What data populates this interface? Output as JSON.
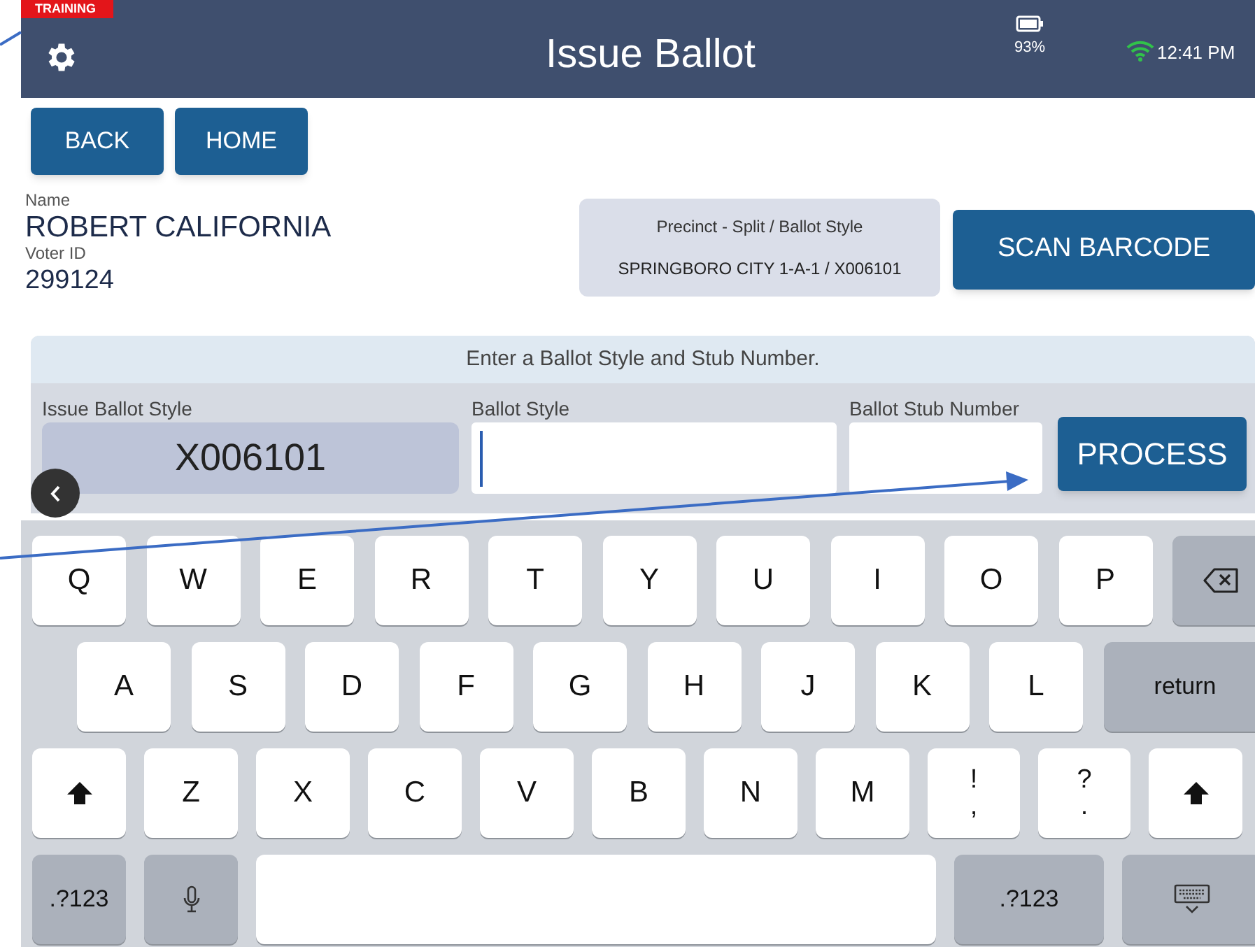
{
  "header": {
    "badge": "TRAINING",
    "title": "Issue Ballot",
    "battery": "93%",
    "time": "12:41 PM"
  },
  "nav_buttons": [
    "BACK",
    "HOME"
  ],
  "voter": {
    "name_label": "Name",
    "name": "ROBERT CALIFORNIA",
    "id_label": "Voter ID",
    "id": "299124"
  },
  "precinct": {
    "label": "Precinct - Split / Ballot Style",
    "value": "SPRINGBORO CITY 1-A-1 / X006101"
  },
  "scan_button": "SCAN BARCODE",
  "entry": {
    "prompt": "Enter a Ballot Style and Stub Number.",
    "issue_label": "Issue Ballot Style",
    "issue_value": "X006101",
    "style_label": "Ballot Style",
    "stub_label": "Ballot Stub Number",
    "process_button": "PROCESS"
  },
  "keyboard": {
    "rows": [
      [
        {
          "kind": "letter",
          "label": "Q"
        },
        {
          "kind": "letter",
          "label": "W"
        },
        {
          "kind": "letter",
          "label": "E"
        },
        {
          "kind": "letter",
          "label": "R"
        },
        {
          "kind": "letter",
          "label": "T"
        },
        {
          "kind": "letter",
          "label": "Y"
        },
        {
          "kind": "letter",
          "label": "U"
        },
        {
          "kind": "letter",
          "label": "I"
        },
        {
          "kind": "letter",
          "label": "O"
        },
        {
          "kind": "letter",
          "label": "P"
        },
        {
          "kind": "backspace"
        }
      ],
      [
        {
          "kind": "letter",
          "label": "A"
        },
        {
          "kind": "letter",
          "label": "S"
        },
        {
          "kind": "letter",
          "label": "D"
        },
        {
          "kind": "letter",
          "label": "F"
        },
        {
          "kind": "letter",
          "label": "G"
        },
        {
          "kind": "letter",
          "label": "H"
        },
        {
          "kind": "letter",
          "label": "J"
        },
        {
          "kind": "letter",
          "label": "K"
        },
        {
          "kind": "letter",
          "label": "L"
        },
        {
          "kind": "return",
          "label": "return"
        }
      ],
      [
        {
          "kind": "shift"
        },
        {
          "kind": "letter",
          "label": "Z"
        },
        {
          "kind": "letter",
          "label": "X"
        },
        {
          "kind": "letter",
          "label": "C"
        },
        {
          "kind": "letter",
          "label": "V"
        },
        {
          "kind": "letter",
          "label": "B"
        },
        {
          "kind": "letter",
          "label": "N"
        },
        {
          "kind": "letter",
          "label": "M"
        },
        {
          "kind": "dual",
          "label": "!",
          "sub": ","
        },
        {
          "kind": "dual",
          "label": "?",
          "sub": "."
        },
        {
          "kind": "shift"
        }
      ],
      [
        {
          "kind": "numbers",
          "label": ".?123"
        },
        {
          "kind": "mic"
        },
        {
          "kind": "space"
        },
        {
          "kind": "numbers_wide",
          "label": ".?123"
        },
        {
          "kind": "hide"
        }
      ]
    ]
  }
}
